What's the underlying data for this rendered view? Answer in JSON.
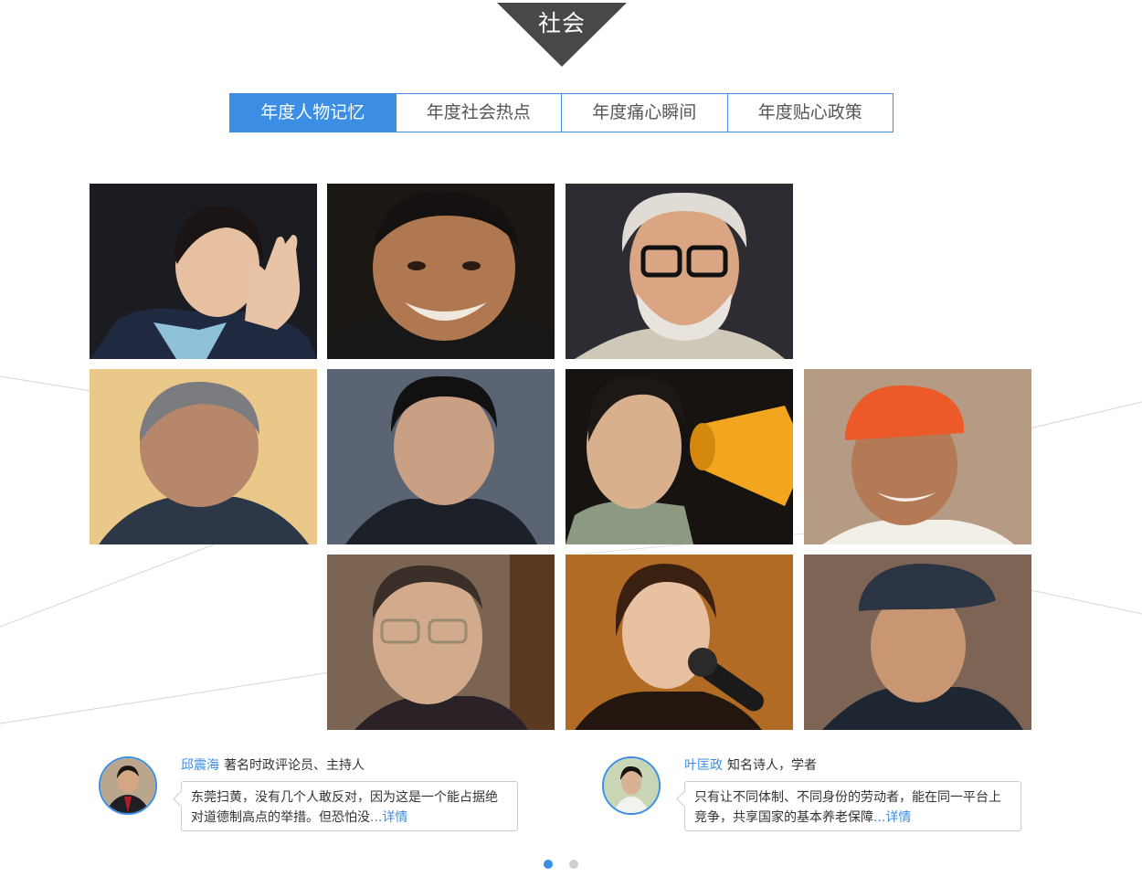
{
  "section": {
    "title": "社会"
  },
  "tabs": [
    {
      "label": "年度人物记忆",
      "active": true
    },
    {
      "label": "年度社会热点",
      "active": false
    },
    {
      "label": "年度痛心瞬间",
      "active": false
    },
    {
      "label": "年度贴心政策",
      "active": false
    }
  ],
  "comments": [
    {
      "name": "邱震海",
      "role": "著名时政评论员、主持人",
      "text": "东莞扫黄，没有几个人敢反对，因为这是一个能占据绝对道德制高点的举措。但恐怕没",
      "more": "...详情"
    },
    {
      "name": "叶匡政",
      "role": "知名诗人，学者",
      "text": "只有让不同体制、不同身份的劳动者，能在同一平台上竞争，共享国家的基本养老保障",
      "more": "...详情"
    }
  ],
  "pagination": {
    "pages": 2,
    "current": 1
  },
  "colors": {
    "accent": "#3b8ee3",
    "badge": "#484848"
  }
}
